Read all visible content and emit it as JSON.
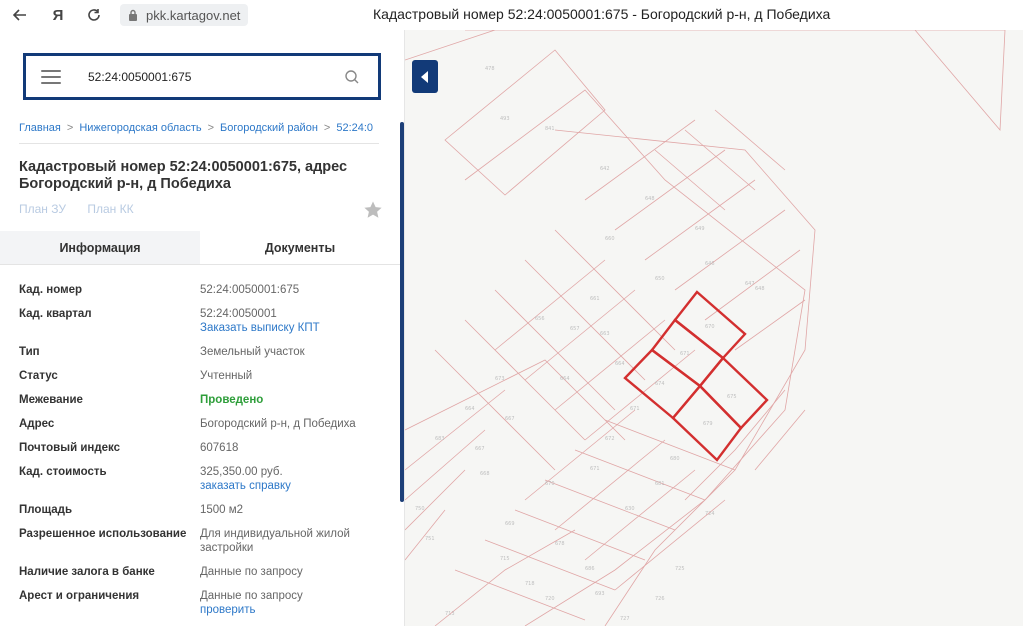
{
  "browser": {
    "url": "pkk.kartagov.net",
    "window_title": "Кадастровый номер 52:24:0050001:675 - Богородский р-н, д Победиха"
  },
  "search": {
    "value": "52:24:0050001:675"
  },
  "breadcrumb": [
    "Главная",
    "Нижегородская область",
    "Богородский район",
    "52:24:0"
  ],
  "title": "Кадастровый номер 52:24:0050001:675, адрес Богородский р-н, д Победиха",
  "plan_links": [
    "План ЗУ",
    "План КК"
  ],
  "tabs": [
    "Информация",
    "Документы"
  ],
  "info": [
    {
      "key": "Кад. номер",
      "value": "52:24:0050001:675",
      "link": ""
    },
    {
      "key": "Кад. квартал",
      "value": "52:24:0050001",
      "link": "Заказать выписку КПТ"
    },
    {
      "key": "Тип",
      "value": "Земельный участок",
      "link": ""
    },
    {
      "key": "Статус",
      "value": "Учтенный",
      "link": ""
    },
    {
      "key": "Межевание",
      "value": "Проведено",
      "link": ""
    },
    {
      "key": "Адрес",
      "value": "Богородский р-н, д Победиха",
      "link": ""
    },
    {
      "key": "Почтовый индекс",
      "value": "607618",
      "link": ""
    },
    {
      "key": "Кад. стоимость",
      "value": "325,350.00 руб.",
      "link": "заказать справку"
    },
    {
      "key": "Площадь",
      "value": "1500 м2",
      "link": ""
    },
    {
      "key": "Разрешенное использование",
      "value": "Для индивидуальной жилой застройки",
      "link": ""
    },
    {
      "key": "Наличие залога в банке",
      "value": "Данные по запросу",
      "link": ""
    },
    {
      "key": "Арест и ограничения",
      "value": "Данные по запросу",
      "link": "проверить"
    }
  ],
  "colors": {
    "accent": "#123a78",
    "link": "#2d78c8",
    "success": "#2e9e3a",
    "parcel_highlight": "#d32f2f"
  }
}
